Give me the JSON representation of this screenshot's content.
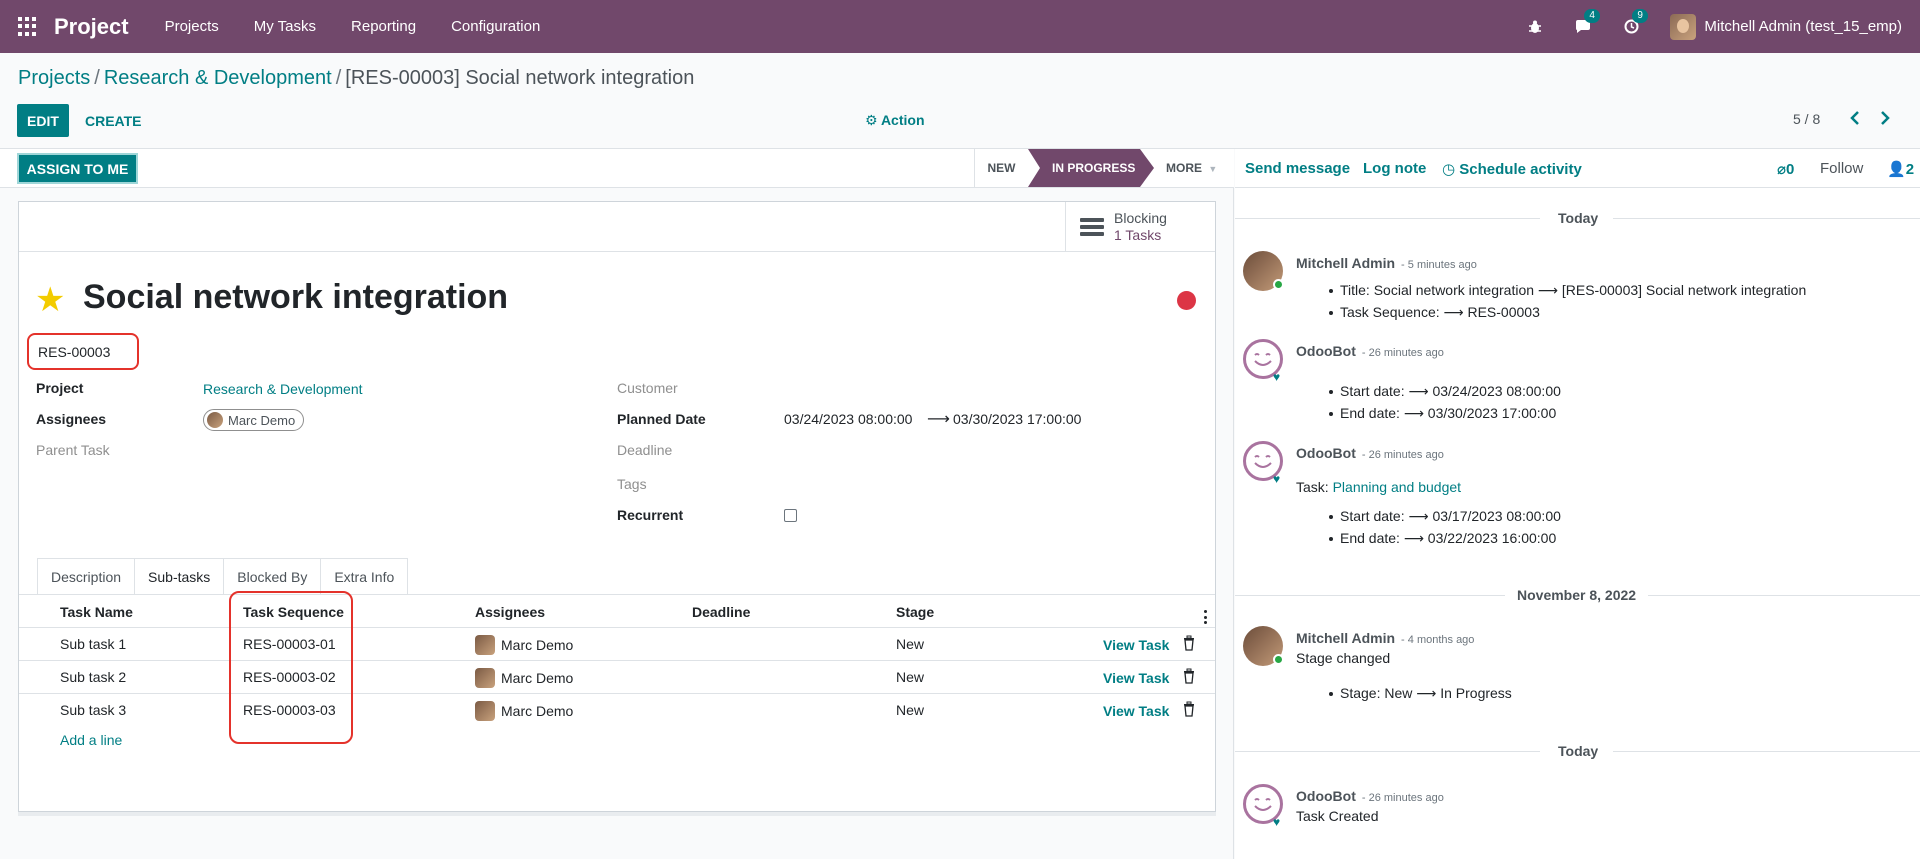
{
  "navbar": {
    "brand": "Project",
    "menu": [
      "Projects",
      "My Tasks",
      "Reporting",
      "Configuration"
    ],
    "messages_count": "4",
    "activities_count": "9",
    "user": "Mitchell Admin (test_15_emp)"
  },
  "breadcrumb": {
    "root": "Projects",
    "project": "Research & Development",
    "current": "[RES-00003] Social network integration"
  },
  "toolbar": {
    "edit": "EDIT",
    "create": "CREATE",
    "action": "Action",
    "pager": "5 / 8"
  },
  "statusbar": {
    "assign": "ASSIGN TO ME",
    "stages": [
      "NEW",
      "IN PROGRESS",
      "MORE"
    ],
    "current_stage": "IN PROGRESS"
  },
  "smart_button": {
    "label": "Blocking",
    "value": "1 Tasks"
  },
  "task": {
    "name": "Social network integration",
    "sequence": "RES-00003",
    "fields": {
      "project_label": "Project",
      "project": "Research & Development",
      "assignees_label": "Assignees",
      "assignee": "Marc Demo",
      "parent_label": "Parent Task",
      "customer_label": "Customer",
      "planned_label": "Planned Date",
      "planned_start": "03/24/2023 08:00:00",
      "planned_arrow": "⟶",
      "planned_end": "03/30/2023 17:00:00",
      "deadline_label": "Deadline",
      "tags_label": "Tags",
      "recurrent_label": "Recurrent"
    }
  },
  "tabs": [
    "Description",
    "Sub-tasks",
    "Blocked By",
    "Extra Info"
  ],
  "active_tab": "Sub-tasks",
  "subtasks": {
    "columns": [
      "Task Name",
      "Task Sequence",
      "Assignees",
      "Deadline",
      "Stage"
    ],
    "rows": [
      {
        "name": "Sub task 1",
        "sequence": "RES-00003-01",
        "assignee": "Marc Demo",
        "deadline": "",
        "stage": "New",
        "view": "View Task"
      },
      {
        "name": "Sub task 2",
        "sequence": "RES-00003-02",
        "assignee": "Marc Demo",
        "deadline": "",
        "stage": "New",
        "view": "View Task"
      },
      {
        "name": "Sub task 3",
        "sequence": "RES-00003-03",
        "assignee": "Marc Demo",
        "deadline": "",
        "stage": "New",
        "view": "View Task"
      }
    ],
    "add_line": "Add a line"
  },
  "chatter": {
    "send_message": "Send message",
    "log_note": "Log note",
    "schedule": "Schedule activity",
    "attachments": "0",
    "follow": "Follow",
    "followers": "2",
    "messages": [
      {
        "separator": "Today"
      },
      {
        "author": "Mitchell Admin",
        "when": "- 5 minutes ago",
        "kind": "human",
        "lines": [
          "Title: Social network integration ⟶ [RES-00003] Social network integration",
          "Task Sequence: ⟶ RES-00003"
        ]
      },
      {
        "author": "OdooBot",
        "when": "- 26 minutes ago",
        "kind": "bot",
        "lines": [
          "Start date: ⟶ 03/24/2023 08:00:00",
          "End date: ⟶ 03/30/2023 17:00:00"
        ]
      },
      {
        "author": "OdooBot",
        "when": "- 26 minutes ago",
        "kind": "bot",
        "prefix": "Task: ",
        "link": "Planning and budget",
        "lines": [
          "Start date: ⟶ 03/17/2023 08:00:00",
          "End date: ⟶ 03/22/2023 16:00:00"
        ]
      },
      {
        "separator": "November 8, 2022"
      },
      {
        "author": "Mitchell Admin",
        "when": "- 4 months ago",
        "kind": "human",
        "body": "Stage changed",
        "lines": [
          "Stage: New ⟶ In Progress"
        ]
      },
      {
        "separator": "Today"
      },
      {
        "author": "OdooBot",
        "when": "- 26 minutes ago",
        "kind": "bot",
        "body": "Task Created"
      }
    ]
  },
  "colors": {
    "navbar": "#71486b",
    "primary": "#017e84",
    "highlight": "#e4322b",
    "priority": "#dc3545",
    "star": "#f3cc00"
  }
}
